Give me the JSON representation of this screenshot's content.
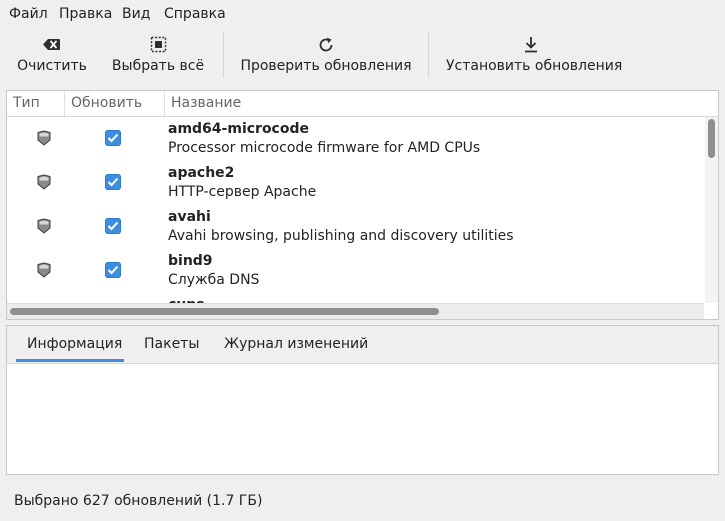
{
  "menubar": {
    "items": [
      {
        "label": "Файл"
      },
      {
        "label": "Правка"
      },
      {
        "label": "Вид"
      },
      {
        "label": "Справка"
      }
    ]
  },
  "toolbar": {
    "clear_label": "Очистить",
    "clear_icon": "clear-backspace-icon",
    "select_all_label": "Выбрать всё",
    "select_all_icon": "select-all-icon",
    "check_updates_label": "Проверить обновления",
    "check_updates_icon": "refresh-icon",
    "install_updates_label": "Установить обновления",
    "install_updates_icon": "download-icon"
  },
  "table": {
    "columns": [
      {
        "label": "Тип"
      },
      {
        "label": "Обновить"
      },
      {
        "label": "Название"
      }
    ],
    "rows": [
      {
        "type_icon": "shield-icon",
        "checked": true,
        "name": "amd64-microcode",
        "description": "Processor microcode firmware for AMD CPUs"
      },
      {
        "type_icon": "shield-icon",
        "checked": true,
        "name": "apache2",
        "description": "HTTP-сервер Apache"
      },
      {
        "type_icon": "shield-icon",
        "checked": true,
        "name": "avahi",
        "description": "Avahi browsing, publishing and discovery utilities"
      },
      {
        "type_icon": "shield-icon",
        "checked": true,
        "name": "bind9",
        "description": "Служба DNS"
      },
      {
        "type_icon": "shield-icon",
        "checked": true,
        "name": "cups",
        "description": ""
      }
    ]
  },
  "details": {
    "tabs": [
      {
        "label": "Информация",
        "active": true
      },
      {
        "label": "Пакеты",
        "active": false
      },
      {
        "label": "Журнал изменений",
        "active": false
      }
    ]
  },
  "status": {
    "text": "Выбрано 627 обновлений (1.7 ГБ)"
  },
  "colors": {
    "accent": "#3d8ee0",
    "background": "#efefef",
    "text": "#232323"
  }
}
